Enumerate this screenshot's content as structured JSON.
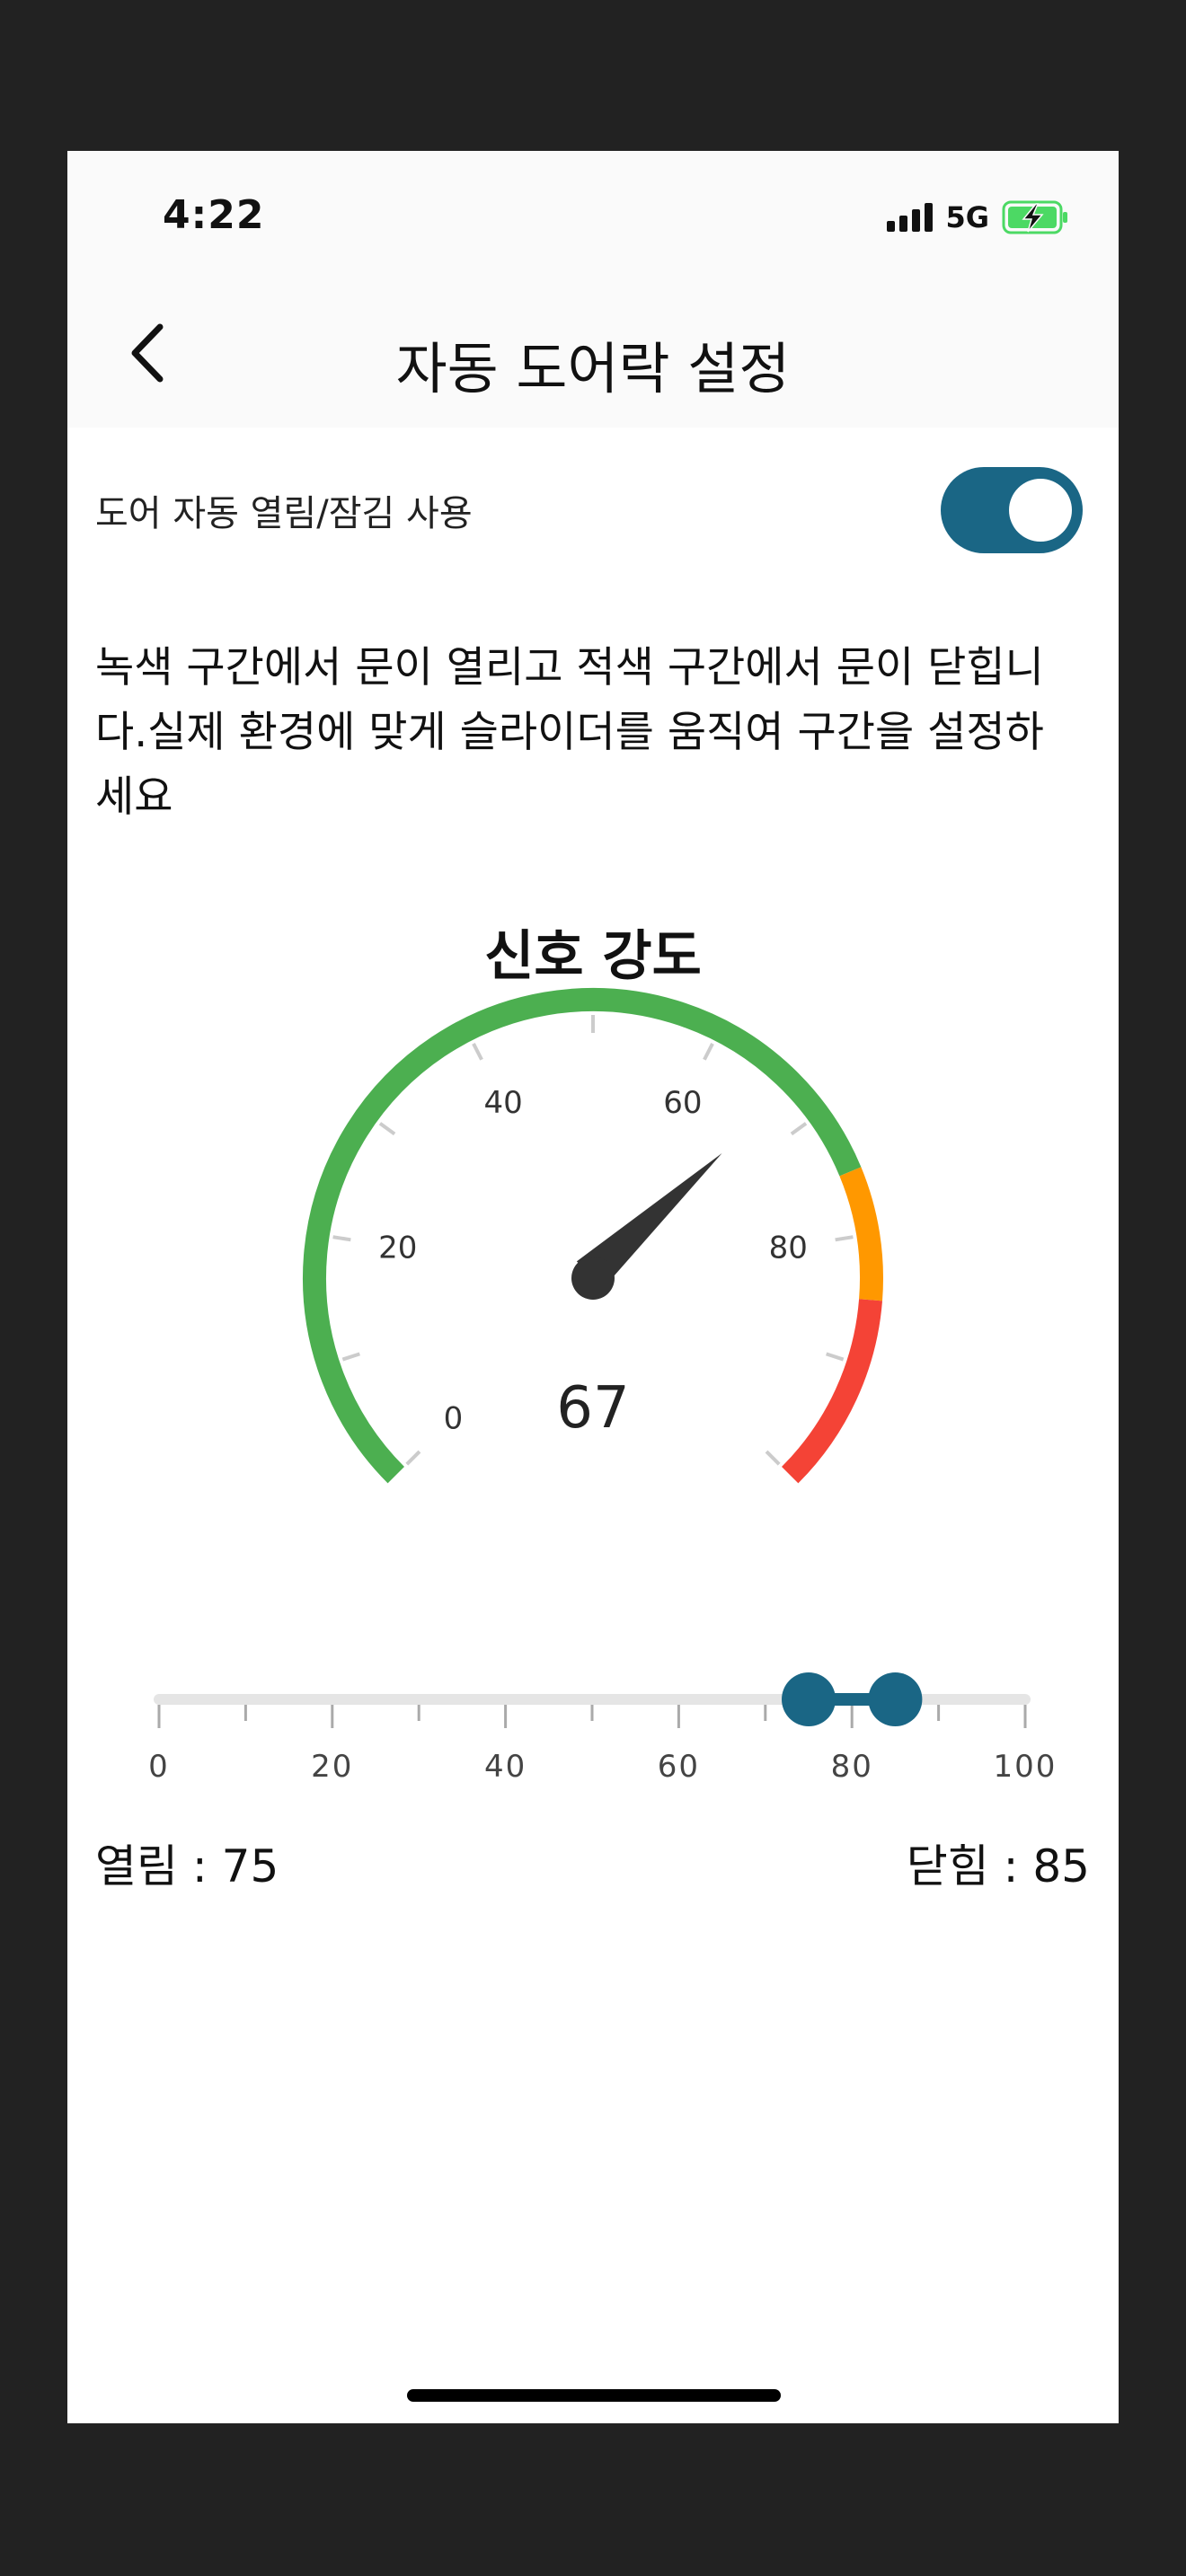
{
  "status_bar": {
    "time": "4:22",
    "network": "5G",
    "battery_icon": "battery-charging-icon",
    "signal_icon": "signal-bars-icon"
  },
  "nav": {
    "title": "자동 도어락 설정",
    "back_icon": "chevron-left-icon"
  },
  "auto_door": {
    "label": "도어 자동 열림/잠김 사용",
    "enabled": true,
    "accent_color": "#1a6685"
  },
  "description_lines": [
    "녹색 구간에서 문이 열리고 적색 구간에서 문이 닫힙니",
    "다.실제 환경에 맞게 슬라이더를 움직여 구간을 설정하",
    "세요"
  ],
  "gauge": {
    "title": "신호 강도",
    "value": 67,
    "value_label": "67",
    "min": 0,
    "max": 100,
    "tick_labels": [
      "0",
      "20",
      "40",
      "60",
      "80"
    ],
    "zones": [
      {
        "name": "open",
        "from": 0,
        "to": 75,
        "color": "#4caf50"
      },
      {
        "name": "transition",
        "from": 75,
        "to": 85,
        "color": "#ff9800"
      },
      {
        "name": "close",
        "from": 85,
        "to": 100,
        "color": "#f44336"
      }
    ],
    "needle_color": "#333333"
  },
  "range_slider": {
    "min": 0,
    "max": 100,
    "open_value": 75,
    "close_value": 85,
    "tick_labels": [
      "0",
      "20",
      "40",
      "60",
      "80",
      "100"
    ],
    "track_color": "#e5e5e5",
    "handle_color": "#1a6685"
  },
  "values": {
    "open_text": "열림 : 75",
    "close_text": "닫힘 : 85"
  }
}
